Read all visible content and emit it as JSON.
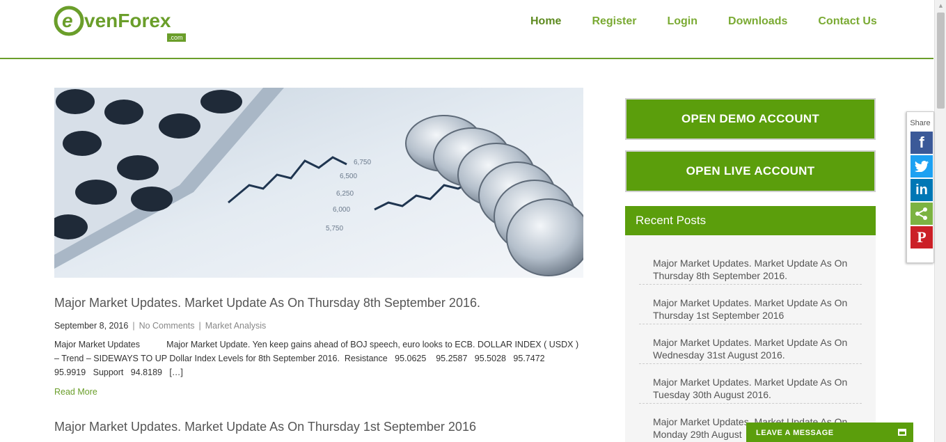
{
  "header": {
    "logo_text": "evenForex",
    "logo_suffix": ".com",
    "nav": [
      {
        "label": "Home"
      },
      {
        "label": "Register"
      },
      {
        "label": "Login"
      },
      {
        "label": "Downloads"
      },
      {
        "label": "Contact Us"
      }
    ]
  },
  "posts": [
    {
      "title": "Major Market Updates. Market Update As On Thursday 8th September 2016.",
      "date": "September 8, 2016",
      "comments": "No Comments",
      "category": "Market Analysis",
      "excerpt": "Major Market Updates           Major Market Update. Yen keep gains ahead of BOJ speech, euro looks to ECB. DOLLAR INDEX ( USDX ) – Trend – SIDEWAYS TO UP Dollar Index Levels for 8th September 2016.  Resistance   95.0625    95.2587   95.5028   95.7472   95.9919   Support   94.8189   […]",
      "read_more": "Read More"
    },
    {
      "title": "Major Market Updates. Market Update As On Thursday 1st September 2016"
    }
  ],
  "sidebar": {
    "demo_button": "OPEN DEMO ACCOUNT",
    "live_button": "OPEN LIVE ACCOUNT",
    "recent_title": "Recent Posts",
    "recent_posts": [
      "Major Market Updates. Market Update As On Thursday 8th September 2016.",
      "Major Market Updates. Market Update As On Thursday 1st September 2016",
      "Major Market Updates. Market Update As On Wednesday 31st August 2016.",
      "Major Market Updates. Market Update As On Tuesday 30th August 2016.",
      "Major Market Updates. Market Update As On Monday 29th August"
    ]
  },
  "share": {
    "label": "Share",
    "buttons": [
      "f",
      "t",
      "in",
      "<",
      "P"
    ]
  },
  "chat": {
    "label": "LEAVE A MESSAGE"
  },
  "colors": {
    "brand_green": "#5b9e0c",
    "nav_green": "#7aaa33"
  }
}
